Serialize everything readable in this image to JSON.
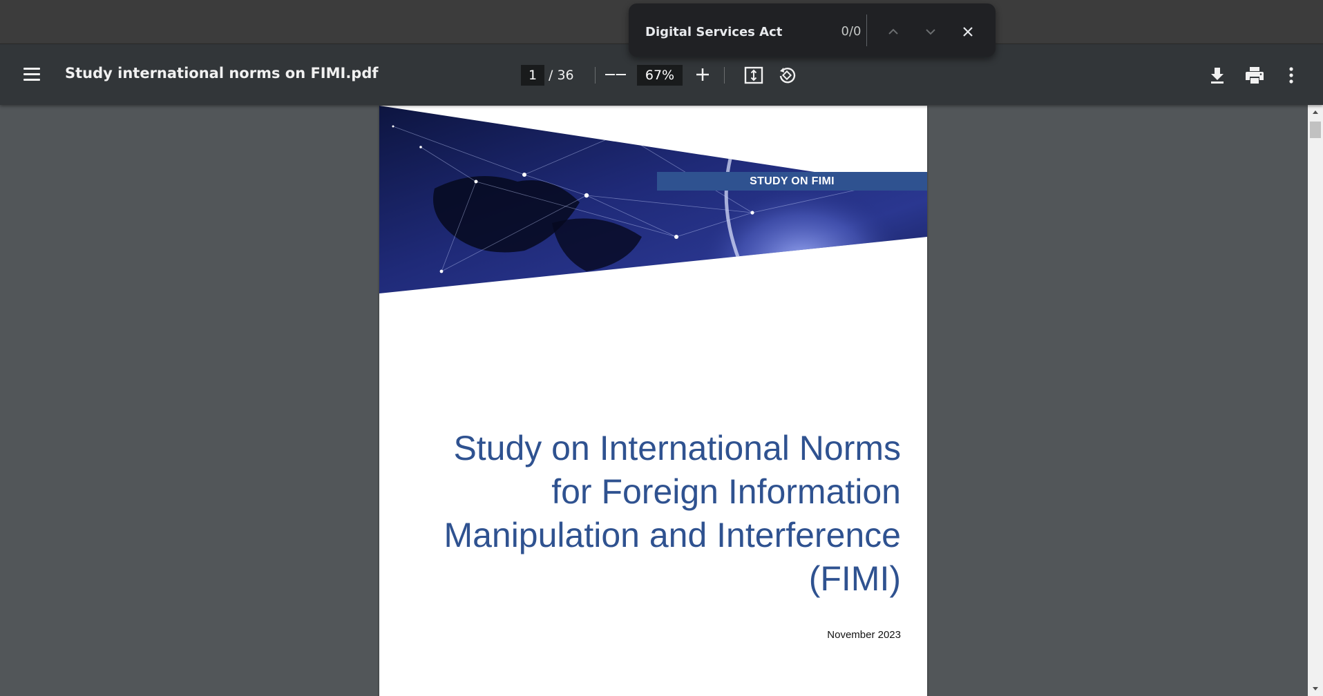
{
  "find": {
    "query": "Digital Services Act",
    "count": "0/0",
    "prev_icon": "chevron-up-icon",
    "next_icon": "chevron-down-icon",
    "close_icon": "close-icon"
  },
  "toolbar": {
    "title": "Study international norms on FIMI.pdf",
    "page_current": "1",
    "page_total": "/ 36",
    "zoom": "67%",
    "icons": [
      "menu-icon",
      "zoom-out-icon",
      "zoom-in-icon",
      "fit-page-icon",
      "rotate-icon",
      "download-icon",
      "print-icon",
      "more-vert-icon"
    ]
  },
  "document": {
    "label": "STUDY ON FIMI",
    "heading_lines": [
      "Study on International Norms",
      "for Foreign Information",
      "Manipulation and Interference",
      "(FIMI)"
    ],
    "date": "November 2023",
    "accent_color": "#2f5290"
  },
  "colors": {
    "toolbar_bg": "#323639",
    "viewer_bg": "#525659",
    "findbar_bg": "#202124"
  }
}
